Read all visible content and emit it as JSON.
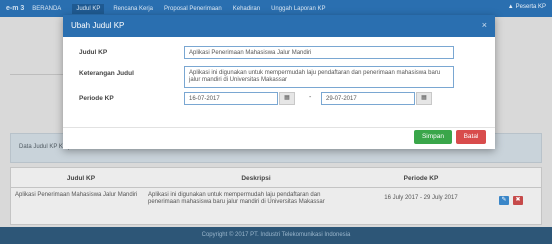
{
  "navbar": {
    "brand": "e-m 3",
    "items": [
      "BERANDA",
      "Judul KP",
      "Rencana Kerja",
      "Proposal Penerimaan",
      "Kehadiran",
      "Unggah Laporan KP"
    ],
    "active_index": 1,
    "user": "Peserta KP"
  },
  "background": {
    "info_text": "Data Judul KP Kerja Praktek",
    "table": {
      "headers": [
        "Judul KP",
        "Deskripsi",
        "Periode KP"
      ],
      "rows": [
        {
          "judul": "Aplikasi Penerimaan Mahasiswa Jalur Mandiri",
          "deskripsi": "Aplikasi ini digunakan untuk mempermudah laju pendaftaran dan penerimaan mahasiswa baru jalur mandiri di Universitas Makassar",
          "periode": "16 July 2017 - 29 July 2017",
          "edit_label": "✎",
          "delete_label": "✖"
        }
      ]
    }
  },
  "footer": {
    "text": "Copyright © 2017 PT. Industri Telekomunikasi Indonesia"
  },
  "modal": {
    "title": "Ubah Judul KP",
    "close_label": "×",
    "fields": {
      "judul": {
        "label": "Judul KP",
        "value": "Aplikasi Penerimaan Mahasiswa Jalur Mandiri"
      },
      "keterangan": {
        "label": "Keterangan Judul",
        "value": "Aplikasi ini digunakan untuk mempermudah laju pendaftaran dan penerimaan mahasiswa baru jalur mandiri di Universitas Makassar"
      },
      "periode": {
        "label": "Periode KP",
        "start": "16-07-2017",
        "end": "29-07-2017",
        "separator": "-"
      }
    },
    "calendar_icon": "▦",
    "save_label": "Simpan",
    "cancel_label": "Batal"
  },
  "colors": {
    "navbar": "#2a6fb0",
    "save": "#3aa64a",
    "cancel": "#d84c4c",
    "footer": "#2d5677"
  }
}
